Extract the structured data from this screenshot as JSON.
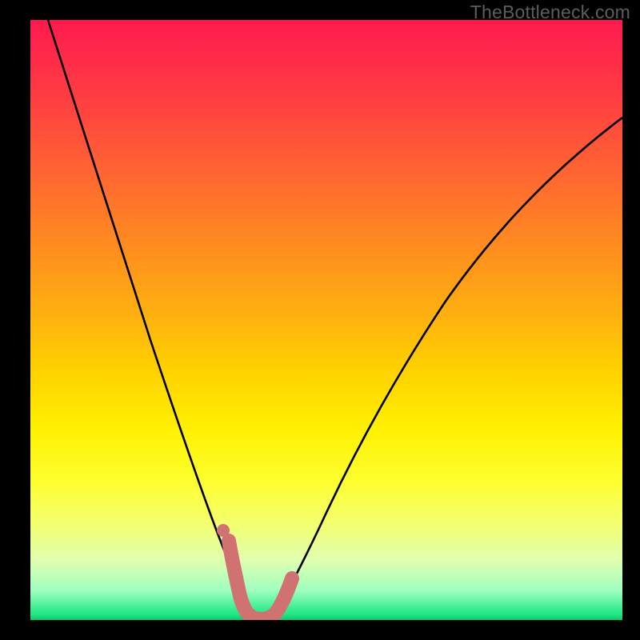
{
  "watermark": "TheBottleneck.com",
  "colors": {
    "background": "#000000",
    "curve": "#000000",
    "marker": "#d17272",
    "watermark": "#5d5d5d"
  },
  "chart_data": {
    "type": "line",
    "title": "",
    "xlabel": "",
    "ylabel": "",
    "xlim": [
      0,
      100
    ],
    "ylim": [
      0,
      100
    ],
    "legend_position": "none",
    "grid": false,
    "series": [
      {
        "name": "bottleneck-curve",
        "x": [
          3,
          5,
          8,
          11,
          14,
          17,
          20,
          23,
          25,
          27,
          29,
          31,
          32.5,
          34,
          36,
          38,
          40,
          42,
          45,
          48,
          52,
          56,
          60,
          64,
          68,
          72,
          76,
          80,
          84,
          88,
          92,
          96,
          100
        ],
        "values": [
          100,
          93,
          85,
          77,
          70,
          62,
          55,
          47,
          42,
          36,
          29,
          22,
          15,
          8,
          2,
          0,
          0,
          2,
          8,
          15,
          22,
          29,
          36,
          42,
          48,
          53,
          58,
          62,
          65.5,
          69,
          72,
          74.5,
          77
        ]
      }
    ],
    "annotations": {
      "minimum_band": {
        "x_start": 34,
        "x_end": 43,
        "value": 0
      },
      "left_marker_dot": {
        "x": 32.7,
        "value": 14
      }
    }
  }
}
